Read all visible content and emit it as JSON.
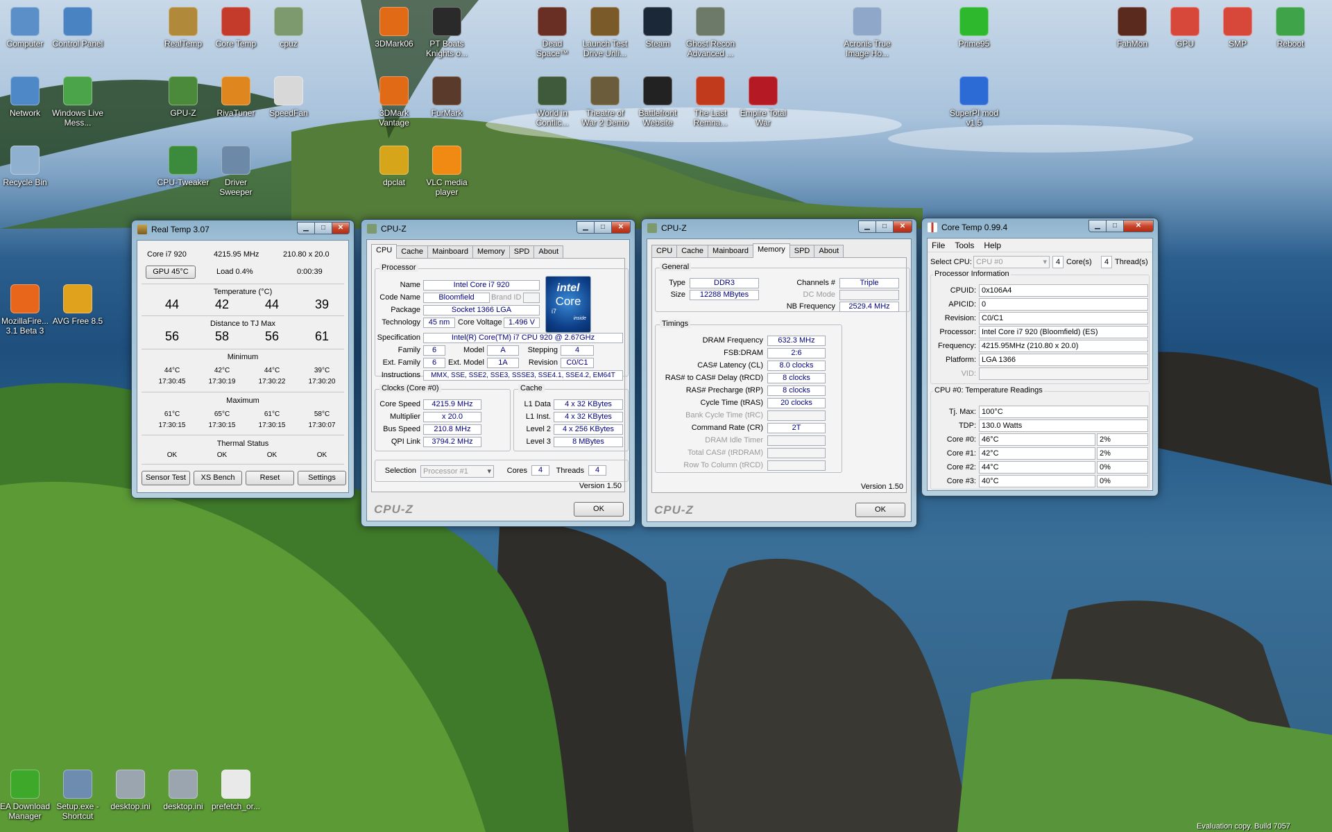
{
  "colors": {
    "accent": "#2b5c8a",
    "cpuz_value": "#00007a",
    "close": "#c8452c"
  },
  "desktop": {
    "icons": [
      {
        "label": "Computer",
        "icon": "computer-icon",
        "color": "#5b8fc7"
      },
      {
        "label": "Control Panel",
        "icon": "control-panel-icon",
        "color": "#4a83c2"
      },
      {
        "label": "RealTemp",
        "icon": "realtemp-icon",
        "color": "#b08a3a"
      },
      {
        "label": "Core Temp",
        "icon": "thermometer-icon",
        "color": "#c43b2c"
      },
      {
        "label": "cpuz",
        "icon": "chip-icon",
        "color": "#7d9a6e"
      },
      {
        "label": "3DMark06",
        "icon": "3dmark-icon",
        "color": "#e06a16"
      },
      {
        "label": "PT Boats Knights o...",
        "icon": "pt-boats-icon",
        "color": "#2a2a2a"
      },
      {
        "label": "Dead Space™",
        "icon": "dead-space-icon",
        "color": "#6a2f24"
      },
      {
        "label": "Launch Test Drive Unli...",
        "icon": "test-drive-icon",
        "color": "#7a5a28"
      },
      {
        "label": "Steam",
        "icon": "steam-icon",
        "color": "#1b2838"
      },
      {
        "label": "Ghost Recon Advanced ...",
        "icon": "ghost-recon-icon",
        "color": "#6d7a6a"
      },
      {
        "label": "Acronis True Image Ho...",
        "icon": "acronis-icon",
        "color": "#8fa8c9"
      },
      {
        "label": "Prime95",
        "icon": "prime95-icon",
        "color": "#2db82d"
      },
      {
        "label": "FahMon",
        "icon": "fahmon-icon",
        "color": "#5a2a1e"
      },
      {
        "label": "GPU",
        "icon": "folding-gpu-icon",
        "color": "#d7473a"
      },
      {
        "label": "SMP",
        "icon": "folding-smp-icon",
        "color": "#d7473a"
      },
      {
        "label": "Reboot",
        "icon": "reboot-arrow-icon",
        "color": "#3fa34a"
      },
      {
        "label": "Network",
        "icon": "network-icon",
        "color": "#4f88c6"
      },
      {
        "label": "Windows Live Mess...",
        "icon": "messenger-icon",
        "color": "#4ba34a"
      },
      {
        "label": "GPU-Z",
        "icon": "gpuz-icon",
        "color": "#4a8a3a"
      },
      {
        "label": "RivaTuner",
        "icon": "rivatuner-icon",
        "color": "#e0861e"
      },
      {
        "label": "SpeedFan",
        "icon": "fan-icon",
        "color": "#d8d8d8"
      },
      {
        "label": "3DMark Vantage",
        "icon": "3dmark-vantage-icon",
        "color": "#e06a16"
      },
      {
        "label": "FurMark",
        "icon": "furmark-icon",
        "color": "#5a3a2a"
      },
      {
        "label": "World in Conflic...",
        "icon": "world-in-conflict-icon",
        "color": "#3e5a3a"
      },
      {
        "label": "Theatre of War 2 Demo",
        "icon": "theatre-of-war-icon",
        "color": "#6b5c3c"
      },
      {
        "label": "Battlefront Website",
        "icon": "battlefront-icon",
        "color": "#222222"
      },
      {
        "label": "The Last Remna...",
        "icon": "last-remnant-icon",
        "color": "#c23a1c"
      },
      {
        "label": "Empire Total War",
        "icon": "empire-total-war-icon",
        "color": "#b51a24"
      },
      {
        "label": "SuperPI mod v1.5",
        "icon": "superpi-icon",
        "color": "#2c6ad6"
      },
      {
        "label": "Recycle Bin",
        "icon": "recycle-bin-icon",
        "color": "#8fb0cf"
      },
      {
        "label": "CPU-Tweaker",
        "icon": "memory-module-icon",
        "color": "#3c8a3c"
      },
      {
        "label": "Driver Sweeper",
        "icon": "driver-sweeper-icon",
        "color": "#6c8aa8"
      },
      {
        "label": "dpclat",
        "icon": "dpclat-bars-icon",
        "color": "#d7a519"
      },
      {
        "label": "VLC media player",
        "icon": "vlc-cone-icon",
        "color": "#f08a12"
      },
      {
        "label": "MozillaFire... 3.1 Beta 3",
        "icon": "firefox-icon",
        "color": "#e7661b"
      },
      {
        "label": "AVG Free 8.5",
        "icon": "avg-icon",
        "color": "#e0a21c"
      },
      {
        "label": "EA Download Manager",
        "icon": "ea-icon",
        "color": "#3ea82a"
      },
      {
        "label": "Setup.exe - Shortcut",
        "icon": "setup-icon",
        "color": "#6d8cb0"
      },
      {
        "label": "desktop.ini",
        "icon": "settings-file-icon",
        "color": "#9aa5b0"
      },
      {
        "label": "desktop.ini",
        "icon": "settings-file-icon",
        "color": "#9aa5b0"
      },
      {
        "label": "prefetch_or...",
        "icon": "text-file-icon",
        "color": "#e9e9e9"
      }
    ],
    "watermark": "Evaluation copy. Build 7057"
  },
  "realtemp": {
    "title": "Real Temp 3.07",
    "cpu": "Core i7 920",
    "mhz": "4215.95 MHz",
    "mult": "210.80 x 20.0",
    "gpu_btn": "GPU 45°C",
    "load": "Load 0.4%",
    "time": "0:00:39",
    "temp_head": "Temperature (°C)",
    "temps": [
      "44",
      "42",
      "44",
      "39"
    ],
    "dist_head": "Distance to TJ Max",
    "dists": [
      "56",
      "58",
      "56",
      "61"
    ],
    "min_head": "Minimum",
    "min_vals": [
      "44°C",
      "42°C",
      "44°C",
      "39°C"
    ],
    "min_times": [
      "17:30:45",
      "17:30:19",
      "17:30:22",
      "17:30:20"
    ],
    "max_head": "Maximum",
    "max_vals": [
      "61°C",
      "65°C",
      "61°C",
      "58°C"
    ],
    "max_times": [
      "17:30:15",
      "17:30:15",
      "17:30:15",
      "17:30:07"
    ],
    "thermal_head": "Thermal Status",
    "thermal": [
      "OK",
      "OK",
      "OK",
      "OK"
    ],
    "buttons": [
      "Sensor Test",
      "XS Bench",
      "Reset",
      "Settings"
    ]
  },
  "cpuz1": {
    "title": "CPU-Z",
    "tabs": [
      "CPU",
      "Cache",
      "Mainboard",
      "Memory",
      "SPD",
      "About"
    ],
    "processor_group": "Processor",
    "name_l": "Name",
    "name": "Intel Core i7 920",
    "code_l": "Code Name",
    "code": "Bloomfield",
    "brand_l": "Brand ID",
    "package_l": "Package",
    "package": "Socket 1366 LGA",
    "tech_l": "Technology",
    "tech": "45 nm",
    "volt_l": "Core Voltage",
    "volt": "1.496 V",
    "spec_l": "Specification",
    "spec": "Intel(R) Core(TM) i7 CPU        920  @ 2.67GHz",
    "family_l": "Family",
    "family": "6",
    "model_l": "Model",
    "model": "A",
    "stepping_l": "Stepping",
    "stepping": "4",
    "extfam_l": "Ext. Family",
    "extfam": "6",
    "extmodel_l": "Ext. Model",
    "extmodel": "1A",
    "revision_l": "Revision",
    "revision": "C0/C1",
    "instr_l": "Instructions",
    "instr": "MMX, SSE, SSE2, SSE3, SSSE3, SSE4.1, SSE4.2, EM64T",
    "logo_brand": "intel",
    "logo_core": "Core",
    "logo_i7": "i7",
    "logo_inside": "inside",
    "clocks_group": "Clocks (Core #0)",
    "speed_l": "Core Speed",
    "speed": "4215.9 MHz",
    "mult_l": "Multiplier",
    "mult": "x 20.0",
    "bus_l": "Bus Speed",
    "bus": "210.8 MHz",
    "qpi_l": "QPI Link",
    "qpi": "3794.2 MHz",
    "cache_group": "Cache",
    "l1d_l": "L1 Data",
    "l1d": "4 x 32 KBytes",
    "l1i_l": "L1 Inst.",
    "l1i": "4 x 32 KBytes",
    "l2_l": "Level 2",
    "l2": "4 x 256 KBytes",
    "l3_l": "Level 3",
    "l3": "8 MBytes",
    "sel_l": "Selection",
    "sel": "Processor #1",
    "cores_l": "Cores",
    "cores": "4",
    "threads_l": "Threads",
    "threads": "4",
    "version": "Version 1.50",
    "logo": "CPU-Z",
    "ok": "OK"
  },
  "cpuz2": {
    "title": "CPU-Z",
    "tabs": [
      "CPU",
      "Cache",
      "Mainboard",
      "Memory",
      "SPD",
      "About"
    ],
    "general_group": "General",
    "type_l": "Type",
    "type": "DDR3",
    "channels_l": "Channels #",
    "channels": "Triple",
    "dc_l": "DC Mode",
    "size_l": "Size",
    "size": "12288 MBytes",
    "nb_l": "NB Frequency",
    "nb": "2529.4 MHz",
    "timings_group": "Timings",
    "timings": [
      {
        "l": "DRAM Frequency",
        "v": "632.3 MHz",
        "g": false
      },
      {
        "l": "FSB:DRAM",
        "v": "2:6",
        "g": false
      },
      {
        "l": "CAS# Latency (CL)",
        "v": "8.0 clocks",
        "g": false
      },
      {
        "l": "RAS# to CAS# Delay (tRCD)",
        "v": "8 clocks",
        "g": false
      },
      {
        "l": "RAS# Precharge (tRP)",
        "v": "8 clocks",
        "g": false
      },
      {
        "l": "Cycle Time (tRAS)",
        "v": "20 clocks",
        "g": false
      },
      {
        "l": "Bank Cycle Time (tRC)",
        "v": "",
        "g": true
      },
      {
        "l": "Command Rate (CR)",
        "v": "2T",
        "g": false
      },
      {
        "l": "DRAM Idle Timer",
        "v": "",
        "g": true
      },
      {
        "l": "Total CAS# (tRDRAM)",
        "v": "",
        "g": true
      },
      {
        "l": "Row To Column (tRCD)",
        "v": "",
        "g": true
      }
    ],
    "version": "Version 1.50",
    "logo": "CPU-Z",
    "ok": "OK"
  },
  "coretemp": {
    "title": "Core Temp 0.99.4",
    "menu": [
      "File",
      "Tools",
      "Help"
    ],
    "select_l": "Select CPU:",
    "select": "CPU #0",
    "cores": "4",
    "cores_l": "Core(s)",
    "threads": "4",
    "threads_l": "Thread(s)",
    "info_head": "Processor Information",
    "info": [
      {
        "l": "CPUID:",
        "v": "0x106A4",
        "g": false
      },
      {
        "l": "APICID:",
        "v": "0",
        "g": false
      },
      {
        "l": "Revision:",
        "v": "C0/C1",
        "g": false
      },
      {
        "l": "Processor:",
        "v": "Intel Core i7 920 (Bloomfield) (ES)",
        "g": false
      },
      {
        "l": "Frequency:",
        "v": "4215.95MHz (210.80 x 20.0)",
        "g": false
      },
      {
        "l": "Platform:",
        "v": "LGA 1366",
        "g": false
      },
      {
        "l": "VID:",
        "v": "",
        "g": true
      }
    ],
    "temp_head": "CPU #0: Temperature Readings",
    "tj_l": "Tj. Max:",
    "tj": "100°C",
    "tdp_l": "TDP:",
    "tdp": "130.0 Watts",
    "cores_list": [
      {
        "l": "Core #0:",
        "t": "46°C",
        "load": "2%"
      },
      {
        "l": "Core #1:",
        "t": "42°C",
        "load": "2%"
      },
      {
        "l": "Core #2:",
        "t": "44°C",
        "load": "0%"
      },
      {
        "l": "Core #3:",
        "t": "40°C",
        "load": "0%"
      }
    ]
  }
}
